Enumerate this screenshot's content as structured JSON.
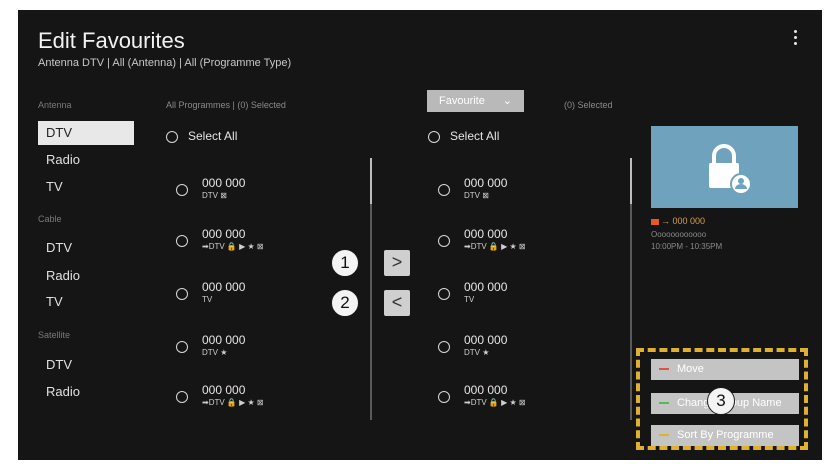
{
  "header": {
    "title": "Edit Favourites",
    "subtitle": "Antenna DTV | All (Antenna) | All (Programme Type)"
  },
  "sidebar": {
    "groups": [
      {
        "label": "Antenna",
        "items": [
          "DTV",
          "Radio",
          "TV"
        ]
      },
      {
        "label": "Cable",
        "items": [
          "DTV",
          "Radio",
          "TV"
        ]
      },
      {
        "label": "Satellite",
        "items": [
          "DTV",
          "Radio"
        ]
      }
    ]
  },
  "left_list": {
    "header": "All Programmes | (0) Selected",
    "select_all": "Select All",
    "channels": [
      {
        "number": "000 000",
        "tags": "DTV ⊠"
      },
      {
        "number": "000 000",
        "tags": "➡DTV 🔒 ▶ ★ ⊠"
      },
      {
        "number": "000 000",
        "tags": "TV"
      },
      {
        "number": "000 000",
        "tags": "DTV ★"
      },
      {
        "number": "000 000",
        "tags": "➡DTV 🔒 ▶ ★ ⊠"
      }
    ]
  },
  "right_list": {
    "dropdown_label": "Favourite",
    "header": "(0) Selected",
    "select_all": "Select All",
    "channels": [
      {
        "number": "000 000",
        "tags": "DTV ⊠"
      },
      {
        "number": "000 000",
        "tags": "➡DTV 🔒 ▶ ★ ⊠"
      },
      {
        "number": "000 000",
        "tags": "TV"
      },
      {
        "number": "000 000",
        "tags": "DTV ★"
      },
      {
        "number": "000 000",
        "tags": "➡DTV 🔒 ▶ ★ ⊠"
      }
    ]
  },
  "transfer": {
    "add_symbol": ">",
    "remove_symbol": "<"
  },
  "callouts": [
    "1",
    "2",
    "3"
  ],
  "preview": {
    "channel": "000 000",
    "programme": "Oooooooooooo",
    "time": "10:00PM - 10:35PM"
  },
  "actions": [
    {
      "label": "Move",
      "color": "#d9534f"
    },
    {
      "label": "Change Group Name",
      "color": "#5cb85c"
    },
    {
      "label": "Sort By Programme",
      "color": "#e0b030"
    }
  ],
  "colors": {
    "background": "#151515",
    "selected_item": "#e8e8e8",
    "highlight_box": "#e0b030",
    "preview_bg": "#6fa3bd"
  }
}
